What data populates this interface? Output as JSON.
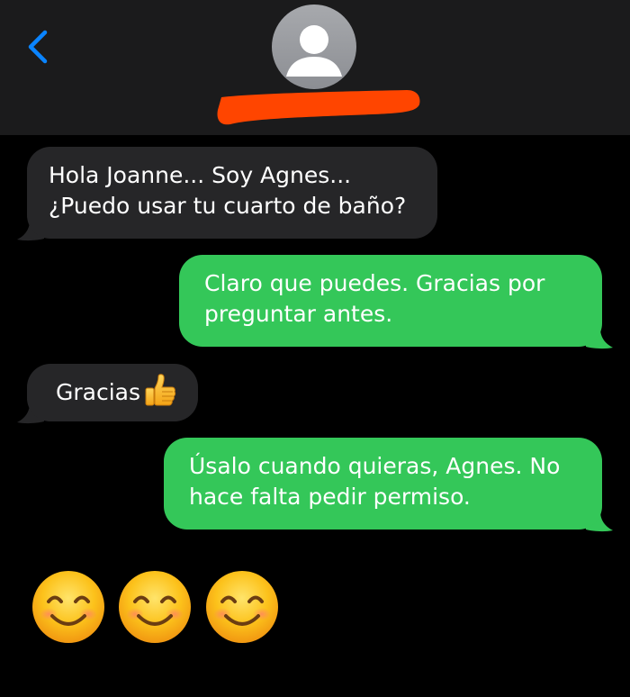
{
  "header": {
    "back_icon": "chevron-left-icon",
    "avatar_icon": "person-silhouette-icon",
    "accent_color": "#0a84ff",
    "redaction_color": "#ff4500"
  },
  "messages": [
    {
      "direction": "received",
      "lines": [
        "Hola Joanne... Soy Agnes...",
        "¿Puedo usar tu cuarto de baño?"
      ]
    },
    {
      "direction": "sent",
      "lines": [
        "Claro que puedes. Gracias por",
        "preguntar antes."
      ]
    },
    {
      "direction": "received",
      "text": "Gracias",
      "emoji": "thumbs-up-icon"
    },
    {
      "direction": "sent",
      "lines": [
        "Úsalo cuando quieras, Agnes. No",
        "hace falta pedir permiso."
      ]
    }
  ],
  "trailing_emojis": [
    "smiling-face-icon",
    "smiling-face-icon",
    "smiling-face-icon"
  ],
  "colors": {
    "received_bubble": "#262628",
    "sent_bubble": "#34c759",
    "background": "#000000",
    "header_background": "#1b1b1c"
  }
}
